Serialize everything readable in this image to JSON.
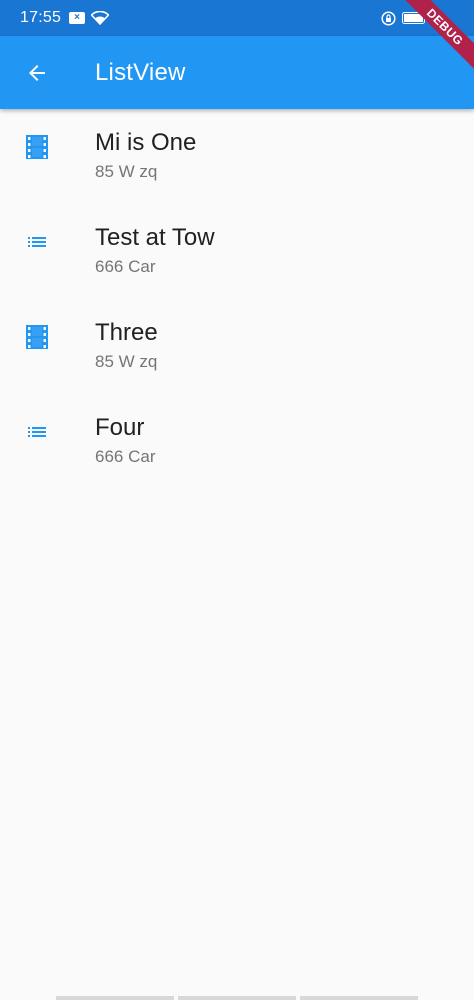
{
  "status_bar": {
    "time": "17:55",
    "icons": [
      "notification-x-icon",
      "wifi-icon",
      "lock-rotation-icon",
      "battery-icon"
    ]
  },
  "app_bar": {
    "back_icon": "arrow-back-icon",
    "title": "ListView"
  },
  "debug_banner": {
    "label": "DEBUG"
  },
  "list": {
    "items": [
      {
        "icon": "movie-icon",
        "title": "Mi is One",
        "subtitle": "85 W zq"
      },
      {
        "icon": "list-icon",
        "title": "Test at Tow",
        "subtitle": "666 Car"
      },
      {
        "icon": "movie-icon",
        "title": "Three",
        "subtitle": "85 W zq"
      },
      {
        "icon": "list-icon",
        "title": "Four",
        "subtitle": "666 Car"
      }
    ]
  },
  "colors": {
    "primary": "#2196f3",
    "primary_dark": "#1976d2",
    "icon": "#2196f3",
    "background": "#fafafa",
    "debug": "#b0224a"
  }
}
